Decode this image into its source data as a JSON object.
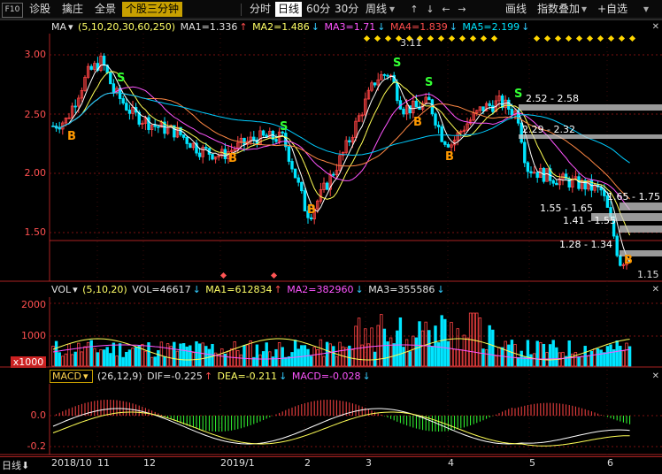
{
  "toolbar": {
    "f10": "F10",
    "diagnose": "诊股",
    "select": "擒庄",
    "full": "全景",
    "three_min": "个股三分钟",
    "periods": [
      "分时",
      "日线",
      "60分",
      "30分",
      "周线"
    ],
    "right": [
      "画线",
      "指数叠加",
      "+自选"
    ]
  },
  "ma_legend": {
    "name": "MA",
    "params": "(5,10,20,30,60,250)",
    "ma1": "MA1=1.336",
    "ma2": "MA2=1.486",
    "ma3": "MA3=1.71",
    "ma4": "MA4=1.839",
    "ma5": "MA5=2.199"
  },
  "vol_legend": {
    "name": "VOL",
    "params": "(5,10,20)",
    "vol": "VOL=46617",
    "ma1": "MA1=612834",
    "ma2": "MA2=382960",
    "ma3": "MA3=355586"
  },
  "macd_legend": {
    "name": "MACD",
    "params": "(26,12,9)",
    "dif": "DIF=-0.225",
    "dea": "DEA=-0.211",
    "macd": "MACD=-0.028"
  },
  "price_axis": [
    "3.00",
    "2.50",
    "2.00",
    "1.50"
  ],
  "vol_axis": [
    "2000",
    "1000",
    "x1000"
  ],
  "macd_axis": [
    "0.0",
    "-0.2"
  ],
  "x_labels": [
    "2018/10",
    "11",
    "12",
    "2019/1",
    "2",
    "3",
    "4",
    "5",
    "6"
  ],
  "bottom_label": "日线",
  "annotations": {
    "high": "3.11",
    "low": "1.15",
    "zones": [
      "2.52 - 2.58",
      "2.29 - 2.32",
      "1.65 - 1.75",
      "1.55 - 1.65",
      "1.41 - 1.55",
      "1.28 - 1.34"
    ]
  },
  "colors": {
    "up": "#ff4444",
    "down": "#00e5ff",
    "grid": "#7a1010",
    "ma1": "#ffffff",
    "ma2": "#ffff55",
    "ma3": "#ff55ff",
    "ma4": "#00ff00",
    "ma5": "#00ccff"
  }
}
